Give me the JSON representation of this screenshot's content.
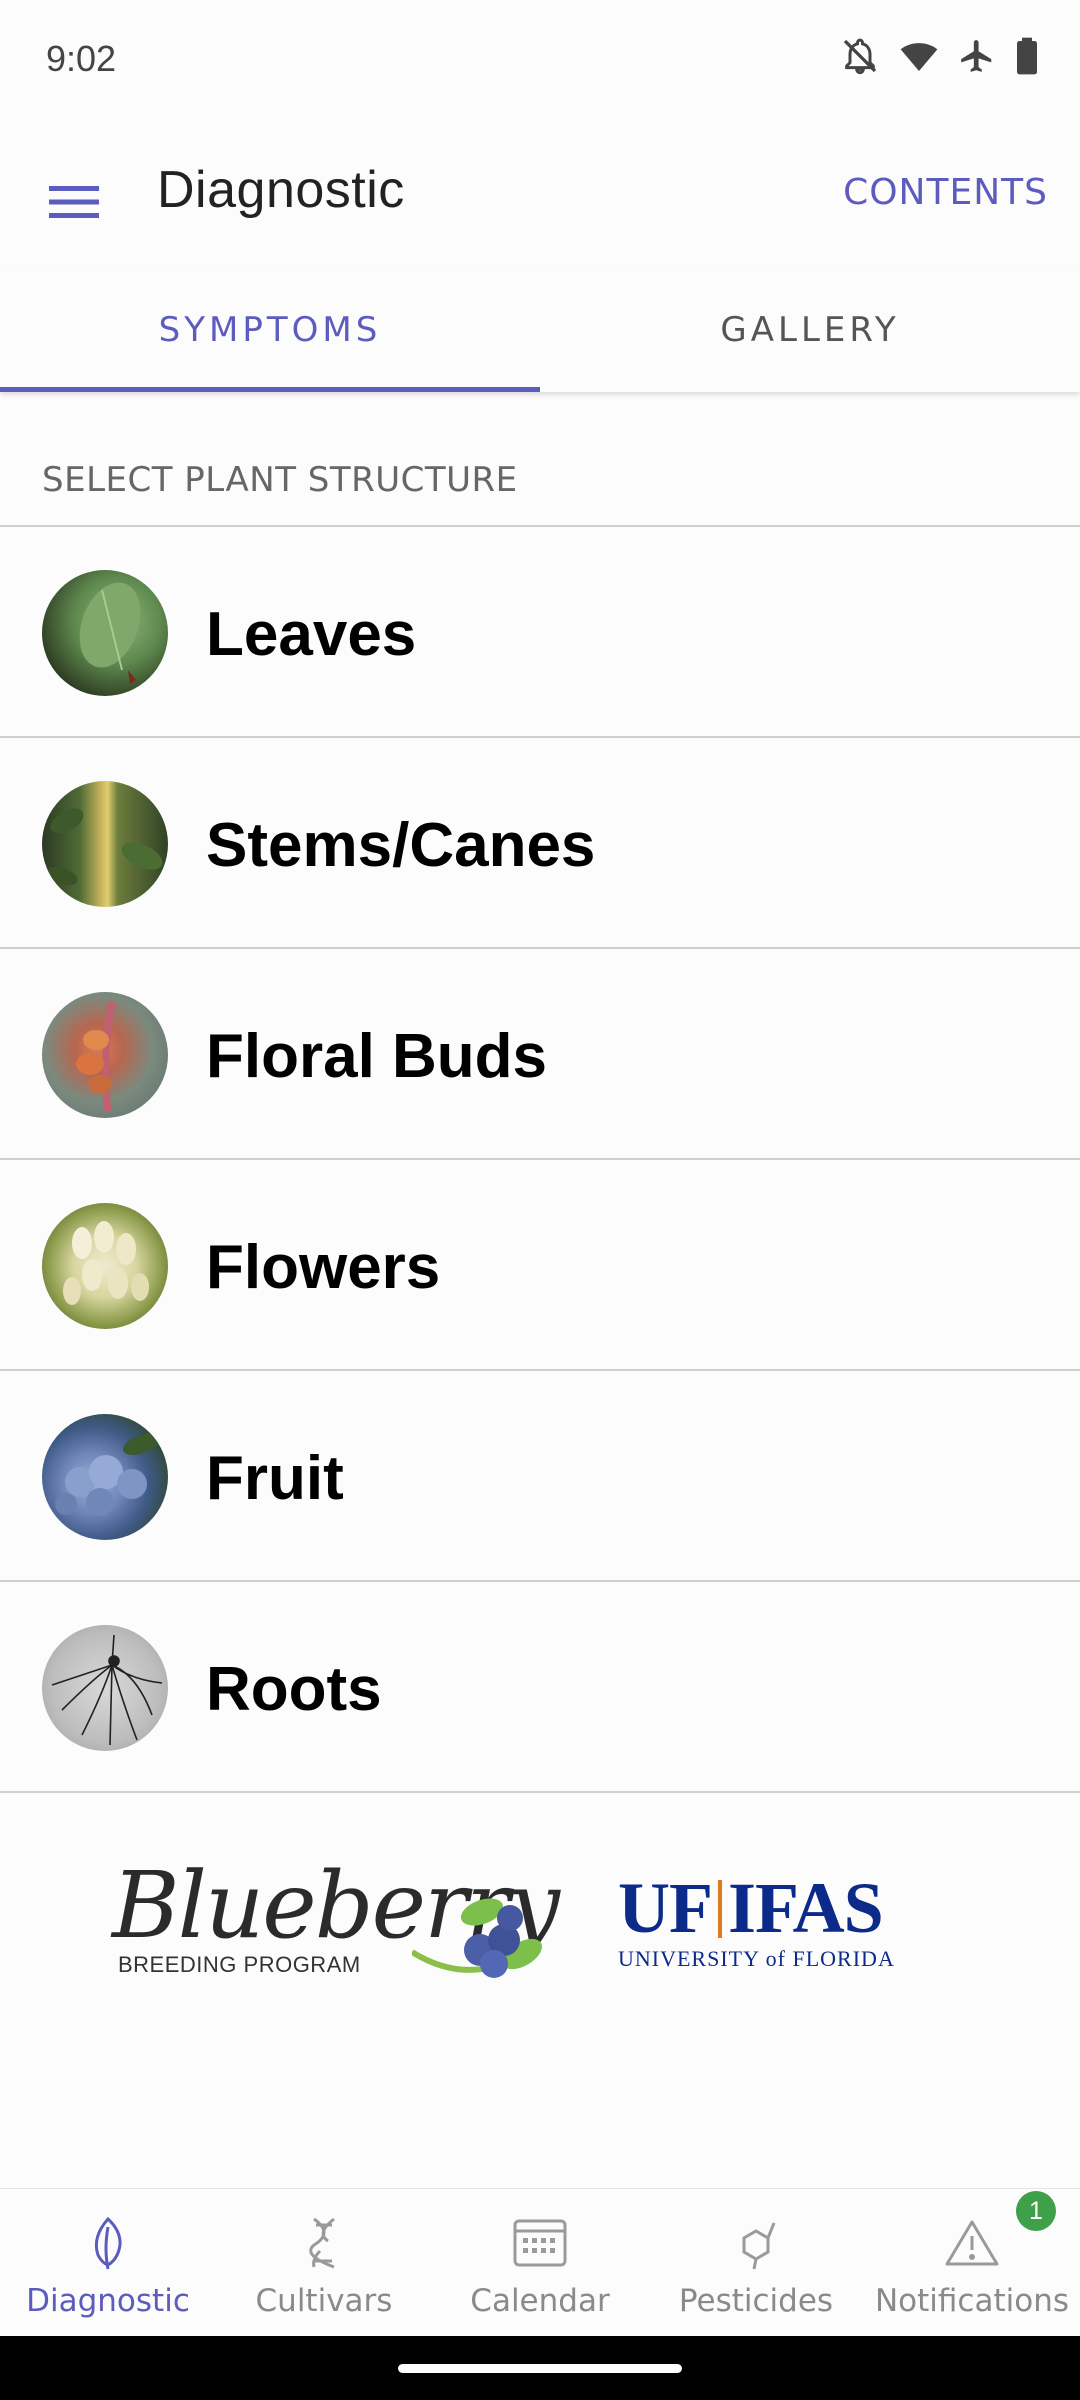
{
  "status_bar": {
    "time": "9:02",
    "icons": [
      "notifications-off-icon",
      "wifi-icon",
      "airplane-icon",
      "battery-icon"
    ]
  },
  "app_bar": {
    "title": "Diagnostic",
    "action_label": "CONTENTS",
    "menu_icon": "hamburger-menu-icon"
  },
  "tabs": [
    {
      "label": "SYMPTOMS",
      "active": true
    },
    {
      "label": "GALLERY",
      "active": false
    }
  ],
  "section_header": "SELECT PLANT STRUCTURE",
  "plant_structures": [
    {
      "label": "Leaves",
      "image": "leaf-photo"
    },
    {
      "label": "Stems/Canes",
      "image": "stem-photo"
    },
    {
      "label": "Floral Buds",
      "image": "floral-bud-photo"
    },
    {
      "label": "Flowers",
      "image": "flower-photo"
    },
    {
      "label": "Fruit",
      "image": "blueberry-fruit-photo"
    },
    {
      "label": "Roots",
      "image": "roots-photo"
    }
  ],
  "logos": {
    "blueberry": {
      "word": "Blueberry",
      "subtitle": "BREEDING PROGRAM"
    },
    "ufifas": {
      "left": "UF",
      "right": "IFAS",
      "subtitle": "UNIVERSITY of FLORIDA"
    }
  },
  "bottom_nav": [
    {
      "label": "Diagnostic",
      "icon": "leaf-outline-icon",
      "active": true
    },
    {
      "label": "Cultivars",
      "icon": "dna-icon",
      "active": false
    },
    {
      "label": "Calendar",
      "icon": "calendar-icon",
      "active": false
    },
    {
      "label": "Pesticides",
      "icon": "molecule-icon",
      "active": false
    },
    {
      "label": "Notifications",
      "icon": "warning-triangle-icon",
      "active": false,
      "badge": "1"
    }
  ],
  "colors": {
    "accent": "#5c5cbf",
    "badge": "#3fa04a",
    "divider": "#cfcfcf"
  }
}
